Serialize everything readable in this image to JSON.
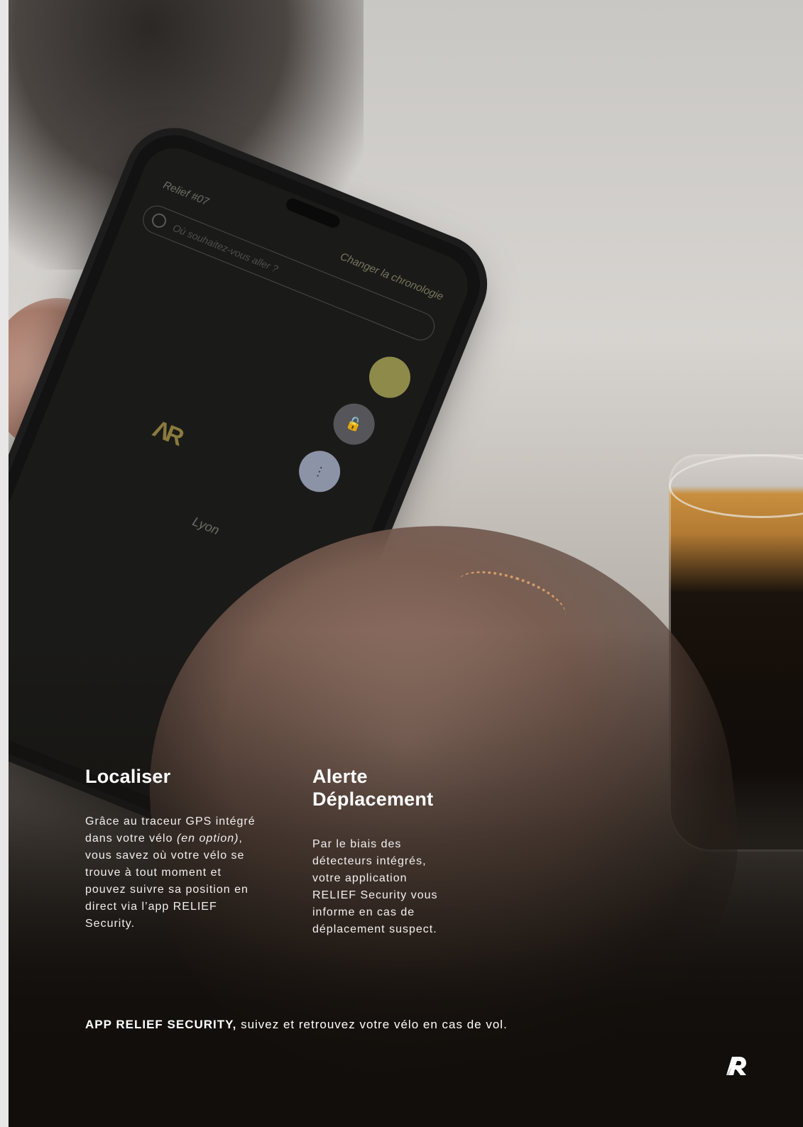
{
  "phone_screen": {
    "app_title": "Relief #07",
    "timeline_link": "Changer la chronologie",
    "search_placeholder": "Où souhaitez-vous aller ?",
    "city_label": "Lyon"
  },
  "sections": [
    {
      "title": "Localiser",
      "body_part1": "Grâce au traceur GPS intégré dans votre vélo ",
      "body_italic": "(en option)",
      "body_part2": ", vous savez où votre vélo se trouve à tout moment et pouvez suivre sa position en direct via l’app RELIEF Security."
    },
    {
      "title": "Alerte Déplacement",
      "body": "Par le biais des détecteurs intégrés, votre application RELIEF Security vous informe en cas de déplacement suspect."
    }
  ],
  "tagline": {
    "bold": "APP RELIEF SECURITY,",
    "rest": " suivez et retrouvez votre vélo en cas de vol."
  },
  "icons": {
    "brand_logo": "relief-r-logo",
    "search": "target-icon",
    "lock": "unlock-icon"
  },
  "colors": {
    "text": "#ffffff",
    "accent_yellow": "#8e8b4a"
  }
}
